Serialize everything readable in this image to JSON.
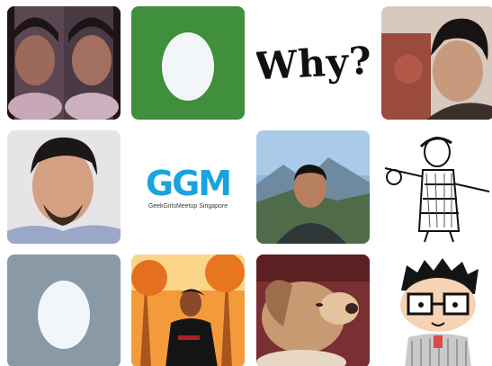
{
  "grid": {
    "tiles": [
      {
        "name": "avatar-twin-women-selfie",
        "kind": "photo"
      },
      {
        "name": "avatar-default-egg-green",
        "kind": "egg",
        "bg": "#3f8f3c"
      },
      {
        "name": "avatar-why-text",
        "kind": "text",
        "text": "Why?"
      },
      {
        "name": "avatar-young-man-portrait",
        "kind": "photo"
      },
      {
        "name": "avatar-bearded-man-selfie",
        "kind": "photo"
      },
      {
        "name": "avatar-ggm-logo",
        "kind": "logo",
        "mark": "GGM",
        "subtitle": "GeekGirlsMeetup Singapore"
      },
      {
        "name": "avatar-man-mountain-view",
        "kind": "photo"
      },
      {
        "name": "avatar-hiker-sketch",
        "kind": "drawing"
      },
      {
        "name": "avatar-default-egg-gray",
        "kind": "egg",
        "bg": "#8a99a6"
      },
      {
        "name": "avatar-man-orange-trees",
        "kind": "photo"
      },
      {
        "name": "avatar-puppy-photo",
        "kind": "photo"
      },
      {
        "name": "avatar-cartoon-boy-glasses",
        "kind": "drawing"
      }
    ]
  },
  "colors": {
    "egg": "#f3f6f9",
    "egg_green_bg": "#3f8f3c",
    "egg_gray_bg": "#8a99a6",
    "ggm_blue": "#1aa3de"
  }
}
